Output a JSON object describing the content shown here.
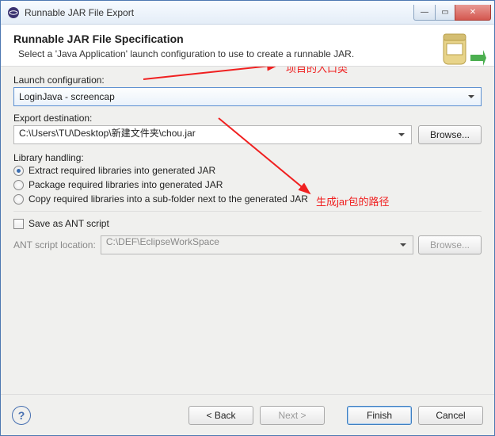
{
  "window": {
    "title": "Runnable JAR File Export"
  },
  "header": {
    "title": "Runnable JAR File Specification",
    "desc": "Select a 'Java Application' launch configuration to use to create a runnable JAR."
  },
  "launch": {
    "label": "Launch configuration:",
    "value": "LoginJava - screencap"
  },
  "export": {
    "label": "Export destination:",
    "value": "C:\\Users\\TU\\Desktop\\新建文件夹\\chou.jar",
    "browse": "Browse..."
  },
  "library": {
    "label": "Library handling:",
    "opt1": "Extract required libraries into generated JAR",
    "opt2": "Package required libraries into generated JAR",
    "opt3": "Copy required libraries into a sub-folder next to the generated JAR"
  },
  "ant": {
    "save": "Save as ANT script",
    "locLabel": "ANT script location:",
    "locValue": "C:\\DEF\\EclipseWorkSpace",
    "browse": "Browse..."
  },
  "footer": {
    "back": "< Back",
    "next": "Next >",
    "finish": "Finish",
    "cancel": "Cancel"
  },
  "annotations": {
    "a1": "项目的入口类",
    "a2": "生成jar包的路径"
  }
}
